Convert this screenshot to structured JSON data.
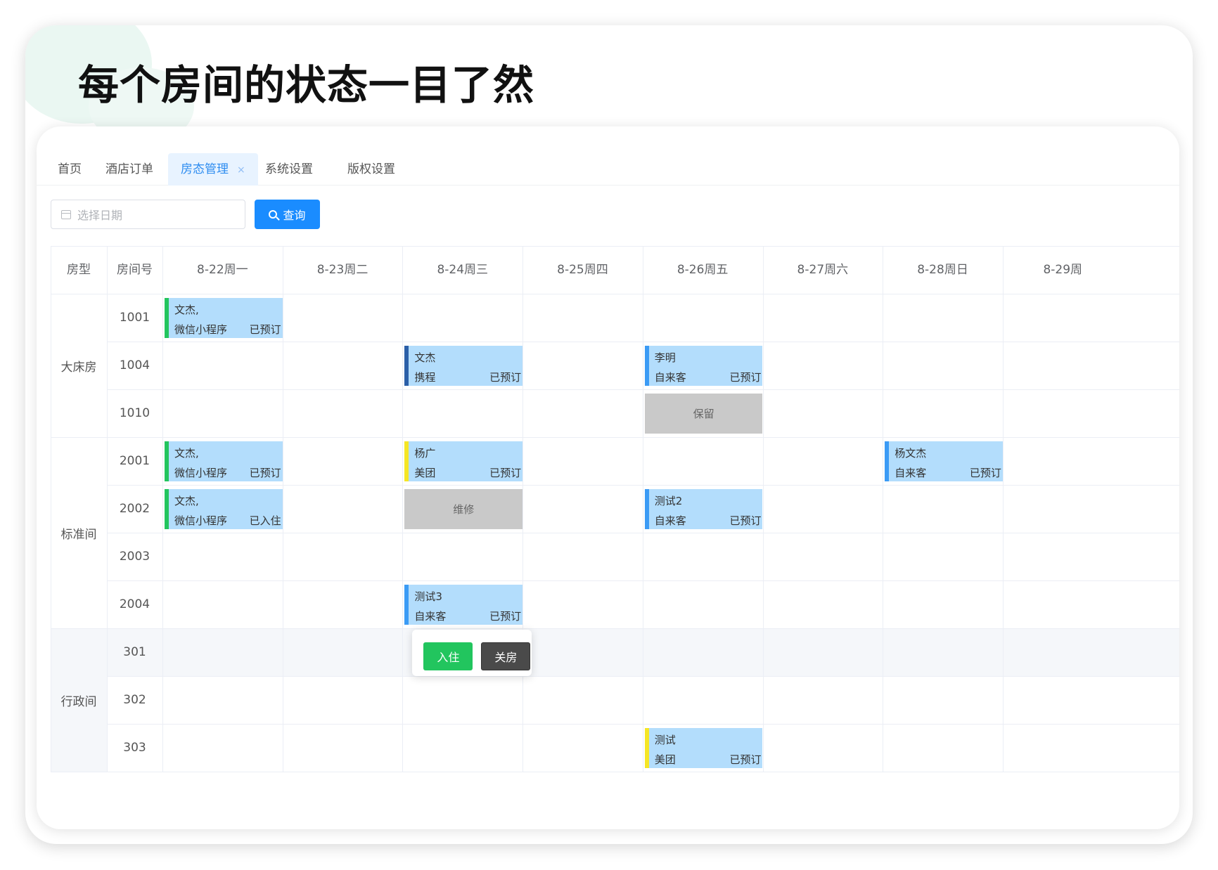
{
  "headline": "每个房间的状态一目了然",
  "tabs": [
    {
      "label": "首页",
      "active": false
    },
    {
      "label": "酒店订单",
      "active": false
    },
    {
      "label": "房态管理",
      "active": true
    },
    {
      "label": "系统设置",
      "active": false
    },
    {
      "label": "版权设置",
      "active": false
    }
  ],
  "tab_close_glyph": "×",
  "search": {
    "date_placeholder": "选择日期",
    "query_label": "查询"
  },
  "table": {
    "type_header": "房型",
    "room_header": "房间号",
    "dates": [
      "8-22周一",
      "8-23周二",
      "8-24周三",
      "8-25周四",
      "8-26周五",
      "8-27周六",
      "8-28周日",
      "8-29周"
    ],
    "groups": [
      {
        "type": "大床房",
        "rooms": [
          "1001",
          "1004",
          "1010"
        ]
      },
      {
        "type": "标准间",
        "rooms": [
          "2001",
          "2002",
          "2003",
          "2004"
        ]
      },
      {
        "type": "行政间",
        "rooms": [
          "301",
          "302",
          "303"
        ]
      }
    ],
    "highlighted_row": "301"
  },
  "bookings": [
    {
      "room": "1001",
      "day": 0,
      "name": "文杰,",
      "source": "微信小程序",
      "status": "已预订",
      "color": "#22c55e"
    },
    {
      "room": "1004",
      "day": 2,
      "name": "文杰",
      "source": "携程",
      "status": "已预订",
      "color": "#2b5fa8"
    },
    {
      "room": "1004",
      "day": 4,
      "name": "李明",
      "source": "自来客",
      "status": "已预订",
      "color": "#3b9bf5"
    },
    {
      "room": "2001",
      "day": 0,
      "name": "文杰,",
      "source": "微信小程序",
      "status": "已预订",
      "color": "#22c55e"
    },
    {
      "room": "2001",
      "day": 2,
      "name": "杨广",
      "source": "美团",
      "status": "已预订",
      "color": "#f5e626"
    },
    {
      "room": "2001",
      "day": 6,
      "name": "杨文杰",
      "source": "自来客",
      "status": "已预订",
      "color": "#3b9bf5"
    },
    {
      "room": "2002",
      "day": 0,
      "name": "文杰,",
      "source": "微信小程序",
      "status": "已入住",
      "color": "#22c55e"
    },
    {
      "room": "2002",
      "day": 4,
      "name": "测试2",
      "source": "自来客",
      "status": "已预订",
      "color": "#3b9bf5"
    },
    {
      "room": "2004",
      "day": 2,
      "name": "测试3",
      "source": "自来客",
      "status": "已预订",
      "color": "#3b9bf5"
    },
    {
      "room": "303",
      "day": 4,
      "name": "测试",
      "source": "美团",
      "status": "已预订",
      "color": "#f5e626"
    }
  ],
  "blocks": [
    {
      "room": "1010",
      "day": 4,
      "label": "保留"
    },
    {
      "room": "2002",
      "day": 2,
      "label": "维修"
    }
  ],
  "popover": {
    "room": "301",
    "day": 2,
    "checkin_label": "入住",
    "close_label": "关房"
  }
}
